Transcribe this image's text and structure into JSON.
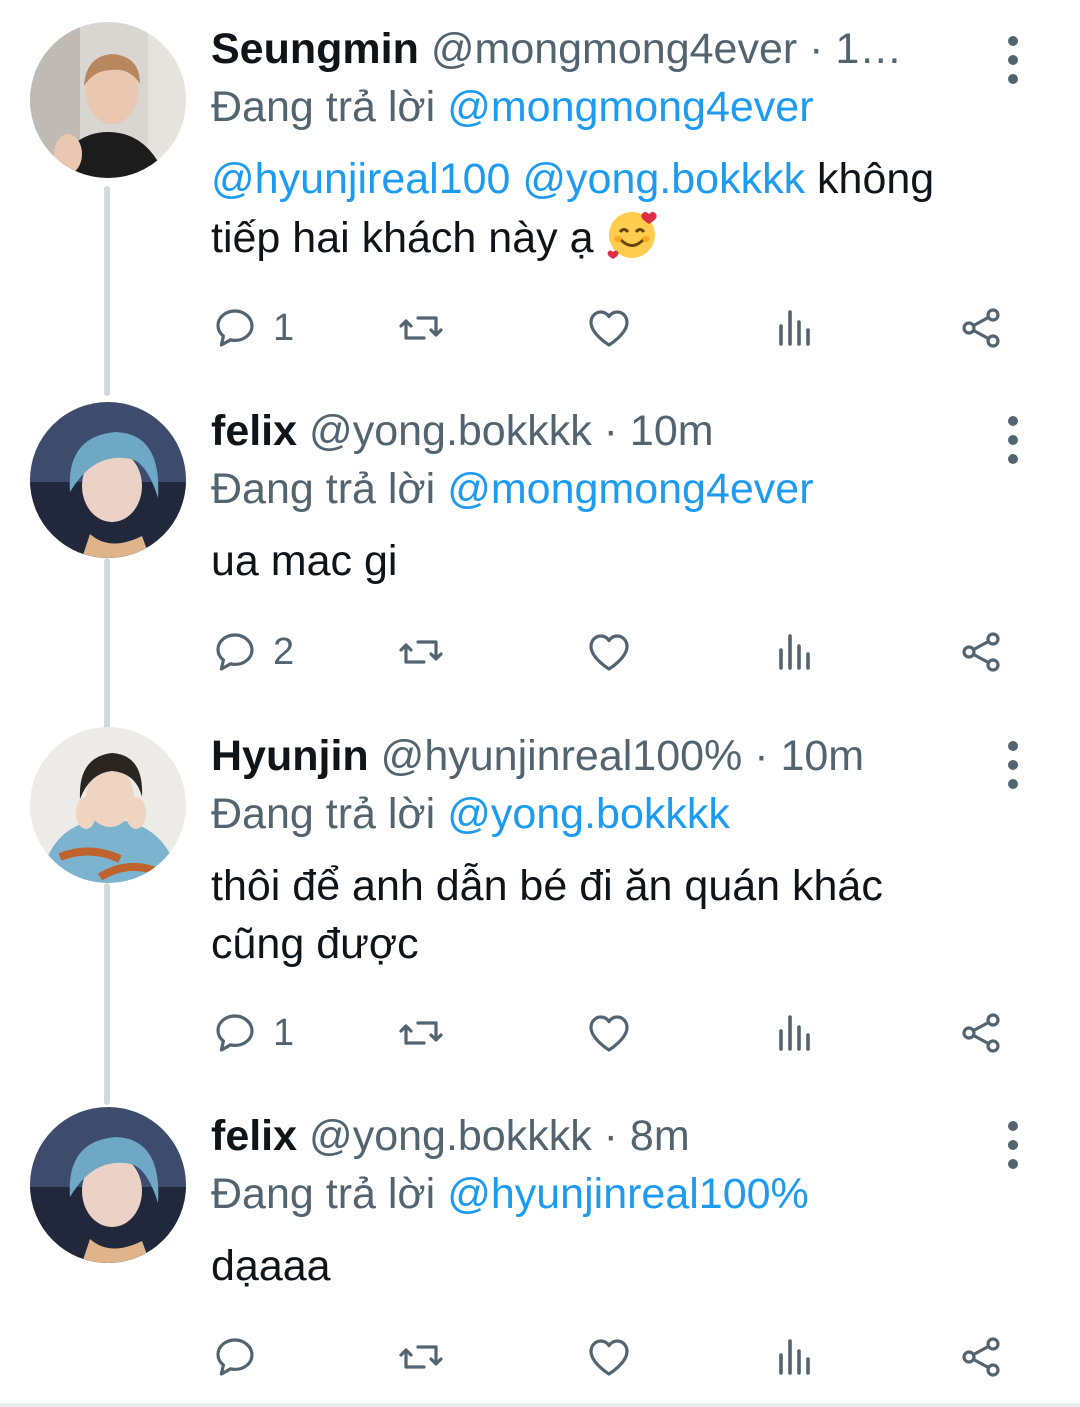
{
  "reply_prefix": "Đang trả lời",
  "tweets": [
    {
      "display_name": "Seungmin",
      "meta": "@mongmong4ever · 1…",
      "reply_to": "@mongmong4ever",
      "mentions": [
        "@hyunjireal100",
        "@yong.bokkkk"
      ],
      "text": "không tiếp hai khách này ạ",
      "emoji": "smiling-face-with-hearts",
      "reply_count": "1",
      "avatar": "avatar-seungmin"
    },
    {
      "display_name": "felix",
      "meta": "@yong.bokkkk · 10m",
      "reply_to": "@mongmong4ever",
      "text": "ua mac gi",
      "reply_count": "2",
      "avatar": "avatar-felix"
    },
    {
      "display_name": "Hyunjin",
      "meta": "@hyunjinreal100% · 10m",
      "reply_to": "@yong.bokkkk",
      "text": "thôi để anh dẫn bé đi ăn quán khác cũng được",
      "reply_count": "1",
      "avatar": "avatar-hyunjin"
    },
    {
      "display_name": "felix",
      "meta": "@yong.bokkkk · 8m",
      "reply_to": "@hyunjinreal100%",
      "text": "dạaaa",
      "reply_count": "",
      "avatar": "avatar-felix"
    }
  ],
  "colors": {
    "link": "#1d9bf0",
    "secondary_text": "#536471",
    "thread_line": "#cfd9de"
  }
}
